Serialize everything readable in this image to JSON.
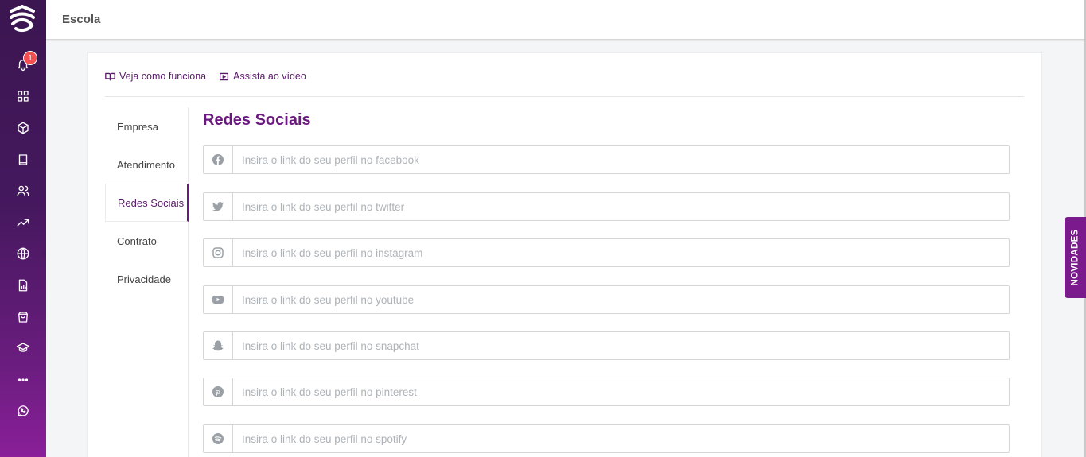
{
  "header": {
    "title": "Escola"
  },
  "notifications": {
    "count": "1"
  },
  "help_links": {
    "how_it_works": "Veja como funciona",
    "watch_video": "Assista ao vídeo"
  },
  "tabs": [
    {
      "label": "Empresa"
    },
    {
      "label": "Atendimento"
    },
    {
      "label": "Redes Sociais",
      "active": true
    },
    {
      "label": "Contrato"
    },
    {
      "label": "Privacidade"
    }
  ],
  "section": {
    "title": "Redes Sociais"
  },
  "fields": {
    "facebook": {
      "placeholder": "Insira o link do seu perfil no facebook",
      "icon": "facebook-icon"
    },
    "twitter": {
      "placeholder": "Insira o link do seu perfil no twitter",
      "icon": "twitter-icon"
    },
    "instagram": {
      "placeholder": "Insira o link do seu perfil no instagram",
      "icon": "instagram-icon"
    },
    "youtube": {
      "placeholder": "Insira o link do seu perfil no youtube",
      "icon": "youtube-icon"
    },
    "snapchat": {
      "placeholder": "Insira o link do seu perfil no snapchat",
      "icon": "snapchat-icon"
    },
    "pinterest": {
      "placeholder": "Insira o link do seu perfil no pinterest",
      "icon": "pinterest-icon"
    },
    "spotify": {
      "placeholder": "Insira o link do seu perfil no spotify",
      "icon": "spotify-icon"
    }
  },
  "novidades": {
    "label": "NOVIDADES"
  },
  "colors": {
    "brand": "#6a1a7f",
    "sidebar_top": "#3b1650",
    "sidebar_bottom": "#8a1f99",
    "badge": "#f05050"
  }
}
